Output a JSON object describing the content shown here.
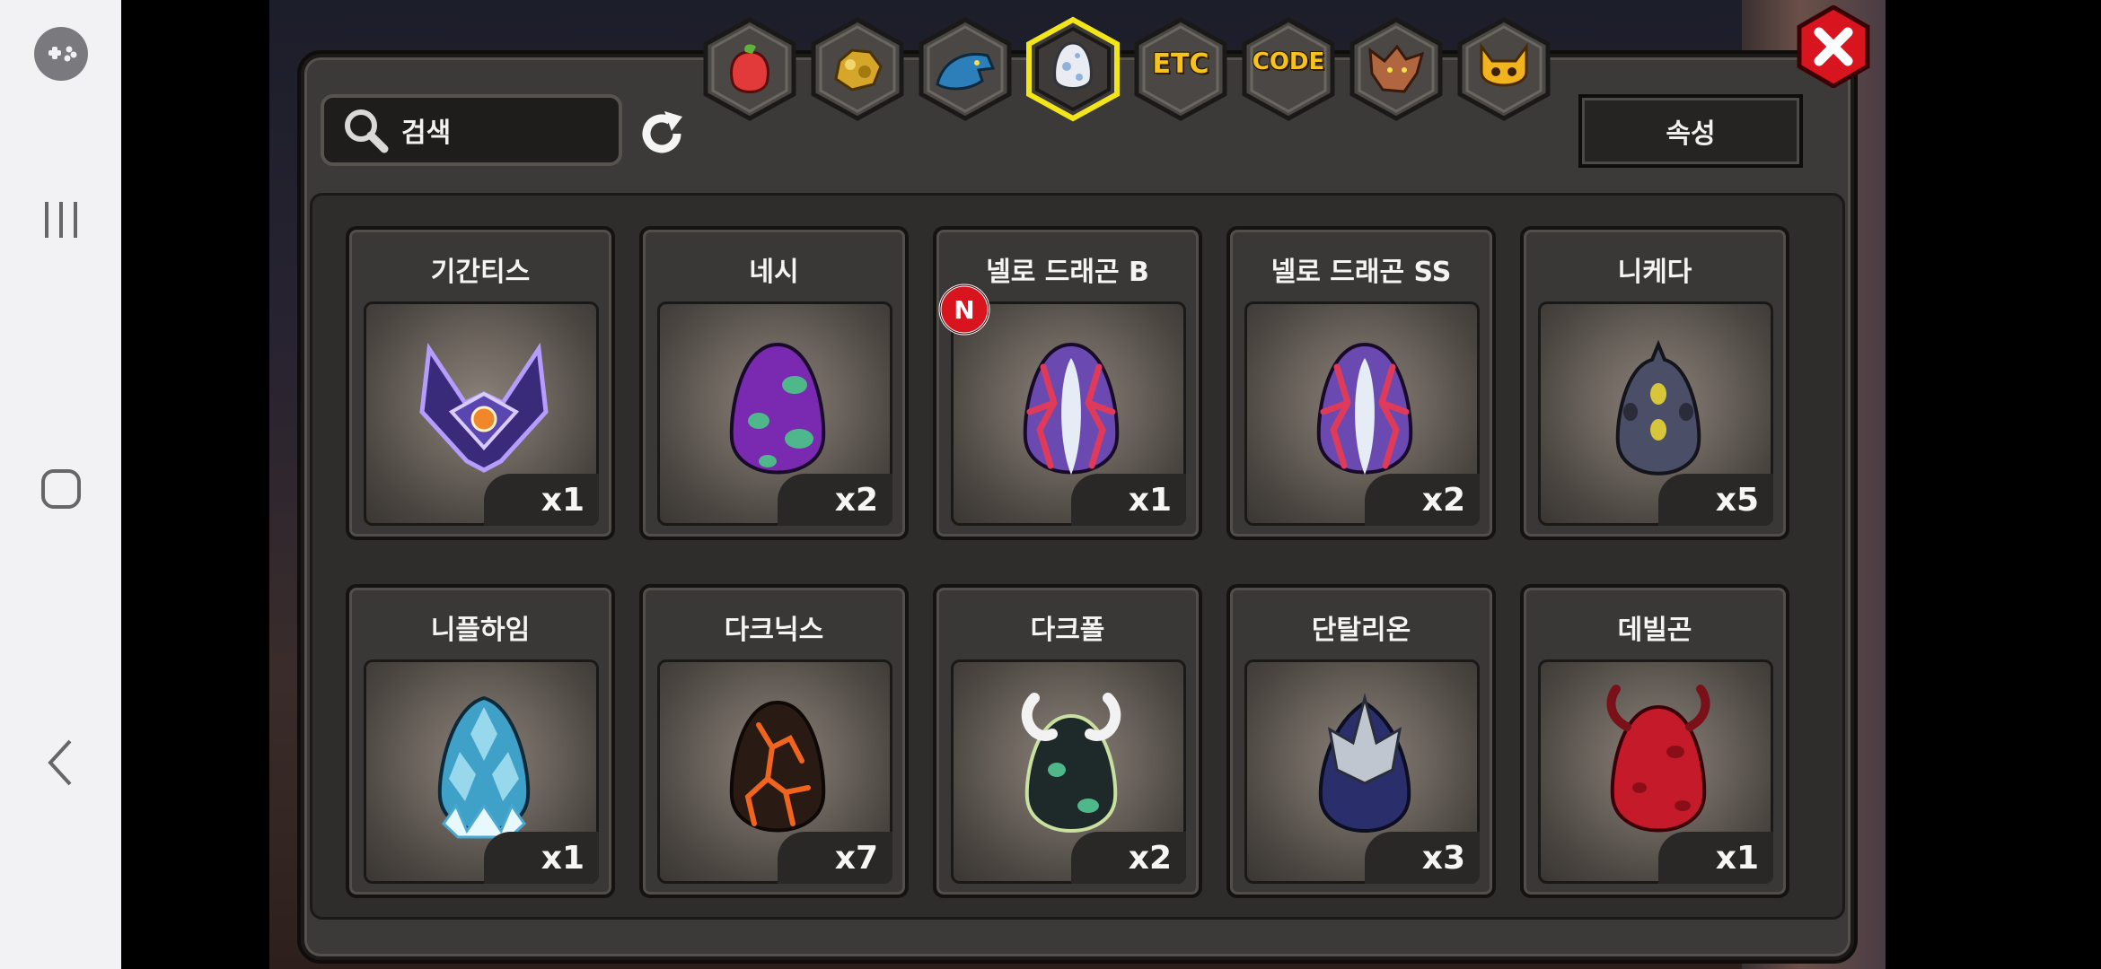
{
  "search": {
    "label": "검색"
  },
  "attribute_button": {
    "label": "속성"
  },
  "tabs": [
    {
      "name": "food-tab",
      "icon": "berry-icon",
      "text": ""
    },
    {
      "name": "material-tab",
      "icon": "gold-nugget-icon",
      "text": ""
    },
    {
      "name": "dragon-tab",
      "icon": "dragon-head-icon",
      "text": ""
    },
    {
      "name": "egg-tab",
      "icon": "egg-icon",
      "text": "",
      "selected": true
    },
    {
      "name": "etc-tab",
      "icon": "",
      "text": "ETC"
    },
    {
      "name": "code-tab",
      "icon": "",
      "text": "CODE"
    },
    {
      "name": "beast-tab",
      "icon": "wolf-head-icon",
      "text": ""
    },
    {
      "name": "monster-tab",
      "icon": "horned-face-icon",
      "text": ""
    }
  ],
  "items": [
    {
      "name": "기간티스",
      "qty": "x1",
      "egg": "crystal-wing"
    },
    {
      "name": "네시",
      "qty": "x2",
      "egg": "purple-spotted"
    },
    {
      "name": "넬로 드래곤 B",
      "qty": "x1",
      "egg": "coral",
      "is_new": true
    },
    {
      "name": "넬로 드래곤 SS",
      "qty": "x2",
      "egg": "coral"
    },
    {
      "name": "니케다",
      "qty": "x5",
      "egg": "dark-gray"
    },
    {
      "name": "니플하임",
      "qty": "x1",
      "egg": "ice"
    },
    {
      "name": "다크닉스",
      "qty": "x7",
      "egg": "lava"
    },
    {
      "name": "다크폴",
      "qty": "x2",
      "egg": "horned-dark"
    },
    {
      "name": "단탈리온",
      "qty": "x3",
      "egg": "armored"
    },
    {
      "name": "데빌곤",
      "qty": "x1",
      "egg": "devil-red"
    }
  ],
  "new_badge": "N",
  "colors": {
    "tab_text": "#f7c21d",
    "selected_tab_border": "#f2e61a",
    "close_button": "#d8141e"
  }
}
